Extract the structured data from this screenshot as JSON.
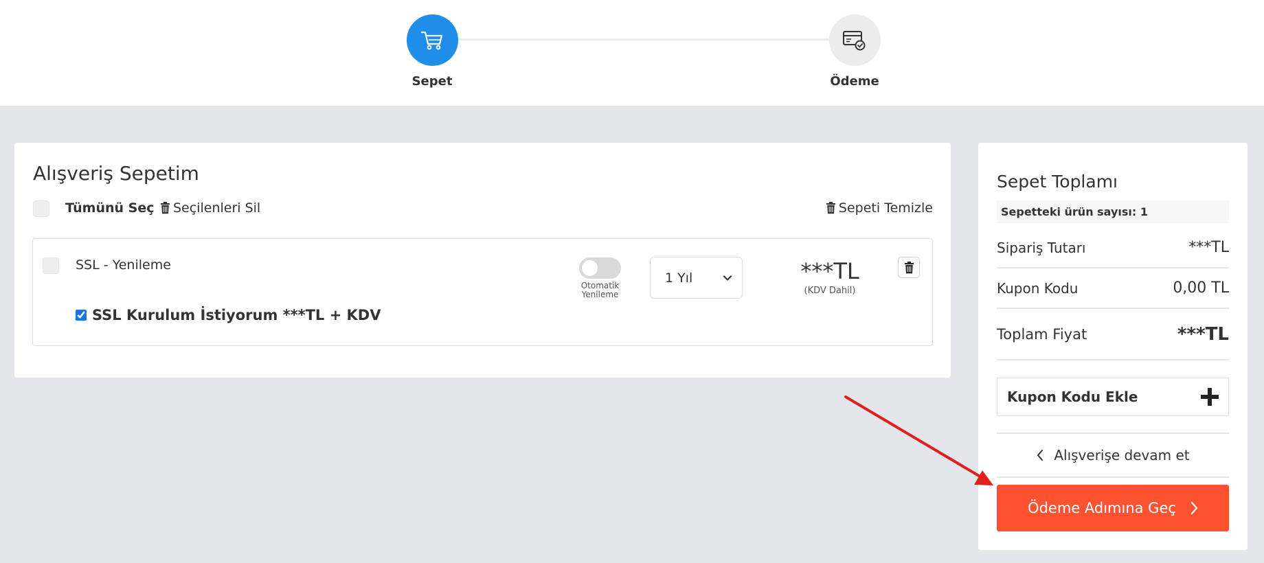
{
  "stepper": {
    "steps": [
      {
        "label": "Sepet",
        "icon": "cart-icon",
        "active": true
      },
      {
        "label": "Ödeme",
        "icon": "payment-card-icon",
        "active": false
      }
    ]
  },
  "cart": {
    "title": "Alışveriş Sepetim",
    "select_all_label": "Tümünü Seç",
    "delete_selected_label": "Seçilenleri Sil",
    "clear_cart_label": "Sepeti Temizle",
    "items": [
      {
        "name": "SSL - Yenileme",
        "auto_renew_label_1": "Otomatik",
        "auto_renew_label_2": "Yenileme",
        "auto_renew_on": false,
        "period": "1 Yıl",
        "price": "***TL",
        "price_note": "(KDV Dahil)",
        "install_option_label": "SSL Kurulum İstiyorum ***TL + KDV",
        "install_option_checked": true
      }
    ]
  },
  "summary": {
    "title": "Sepet Toplamı",
    "item_count_label": "Sepetteki ürün sayısı: 1",
    "order_amount_label": "Sipariş Tutarı",
    "order_amount_value": "***TL",
    "coupon_label": "Kupon Kodu",
    "coupon_value": "0,00 TL",
    "total_label": "Toplam Fiyat",
    "total_value": "***TL",
    "add_coupon_label": "Kupon Kodu Ekle",
    "continue_label": "Alışverişe devam et",
    "checkout_label": "Ödeme Adımına Geç"
  },
  "colors": {
    "primary_blue": "#1f8ee8",
    "checkout_orange": "#fe5230",
    "annotation_arrow": "#e02020",
    "page_bg": "#e4e6ea"
  }
}
